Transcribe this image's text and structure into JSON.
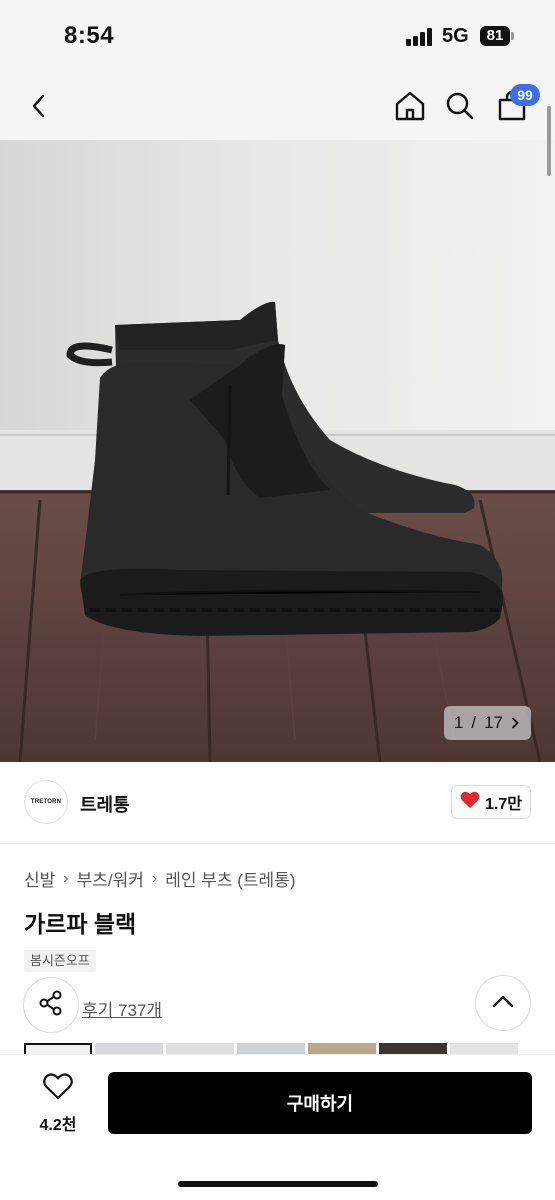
{
  "status_bar": {
    "time": "8:54",
    "network": "5G",
    "battery": "81"
  },
  "nav": {
    "icons": [
      "back-arrow-icon",
      "home-icon",
      "search-icon",
      "cart-icon"
    ],
    "cart_badge": "99"
  },
  "image": {
    "counter_current": "1",
    "counter_separator": "/",
    "counter_total": "17",
    "alt_subject": "black chelsea rain boots"
  },
  "brand": {
    "logo_text": "TRETORN",
    "name": "트레통",
    "likes": "1.7만",
    "like_color": "#e8262d"
  },
  "breadcrumb": [
    "신발",
    "부츠/워커",
    "레인 부츠 (트레통)"
  ],
  "product": {
    "title": "가르파 블랙",
    "season_tag": "봄시즌오프",
    "reviews": "후기 737개"
  },
  "bottom_bar": {
    "wish_count": "4.2천",
    "buy_label": "구매하기",
    "accent": "#000000"
  }
}
